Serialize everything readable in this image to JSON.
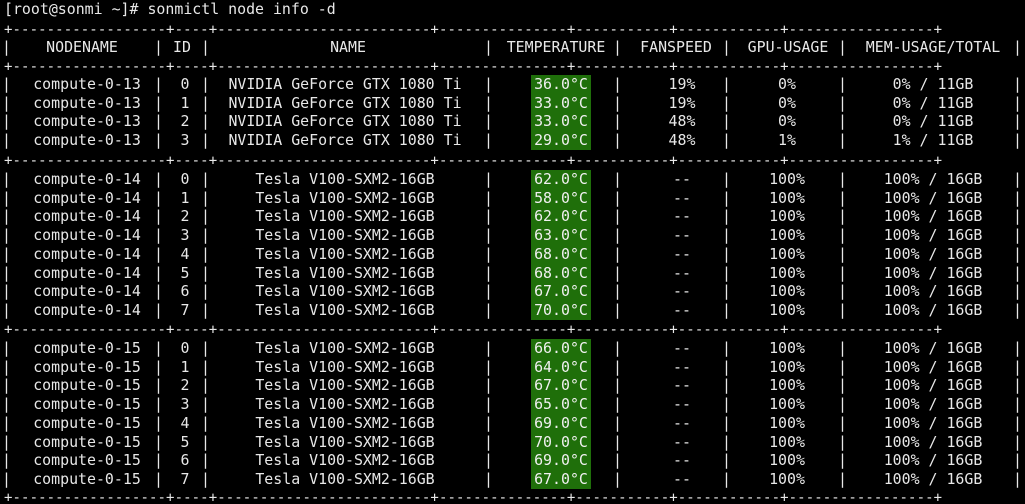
{
  "terminal": {
    "prompt": "[root@sonmi ~]# ",
    "command": "sonmictl node info -d",
    "separator": "+------------------+----+-------------------------+---------------+-----------+------------+-----------------+",
    "headers": {
      "nodename": "NODENAME",
      "id": "ID",
      "name": "NAME",
      "temperature": "TEMPERATURE",
      "fanspeed": "FANSPEED",
      "gpu_usage": "GPU-USAGE",
      "mem_usage": "MEM-USAGE/TOTAL"
    },
    "groups": [
      {
        "rows": [
          {
            "node": "compute-0-13",
            "id": "0",
            "name": "NVIDIA GeForce GTX 1080 Ti",
            "temp": "36.0°C",
            "fan": "19%",
            "gpu": "0%",
            "mem": "0% / 11GB"
          },
          {
            "node": "compute-0-13",
            "id": "1",
            "name": "NVIDIA GeForce GTX 1080 Ti",
            "temp": "33.0°C",
            "fan": "19%",
            "gpu": "0%",
            "mem": "0% / 11GB"
          },
          {
            "node": "compute-0-13",
            "id": "2",
            "name": "NVIDIA GeForce GTX 1080 Ti",
            "temp": "33.0°C",
            "fan": "48%",
            "gpu": "0%",
            "mem": "0% / 11GB"
          },
          {
            "node": "compute-0-13",
            "id": "3",
            "name": "NVIDIA GeForce GTX 1080 Ti",
            "temp": "29.0°C",
            "fan": "48%",
            "gpu": "1%",
            "mem": "1% / 11GB"
          }
        ]
      },
      {
        "rows": [
          {
            "node": "compute-0-14",
            "id": "0",
            "name": "Tesla V100-SXM2-16GB",
            "temp": "62.0°C",
            "fan": "--",
            "gpu": "100%",
            "mem": "100% / 16GB"
          },
          {
            "node": "compute-0-14",
            "id": "1",
            "name": "Tesla V100-SXM2-16GB",
            "temp": "58.0°C",
            "fan": "--",
            "gpu": "100%",
            "mem": "100% / 16GB"
          },
          {
            "node": "compute-0-14",
            "id": "2",
            "name": "Tesla V100-SXM2-16GB",
            "temp": "62.0°C",
            "fan": "--",
            "gpu": "100%",
            "mem": "100% / 16GB"
          },
          {
            "node": "compute-0-14",
            "id": "3",
            "name": "Tesla V100-SXM2-16GB",
            "temp": "63.0°C",
            "fan": "--",
            "gpu": "100%",
            "mem": "100% / 16GB"
          },
          {
            "node": "compute-0-14",
            "id": "4",
            "name": "Tesla V100-SXM2-16GB",
            "temp": "68.0°C",
            "fan": "--",
            "gpu": "100%",
            "mem": "100% / 16GB"
          },
          {
            "node": "compute-0-14",
            "id": "5",
            "name": "Tesla V100-SXM2-16GB",
            "temp": "68.0°C",
            "fan": "--",
            "gpu": "100%",
            "mem": "100% / 16GB"
          },
          {
            "node": "compute-0-14",
            "id": "6",
            "name": "Tesla V100-SXM2-16GB",
            "temp": "67.0°C",
            "fan": "--",
            "gpu": "100%",
            "mem": "100% / 16GB"
          },
          {
            "node": "compute-0-14",
            "id": "7",
            "name": "Tesla V100-SXM2-16GB",
            "temp": "70.0°C",
            "fan": "--",
            "gpu": "100%",
            "mem": "100% / 16GB"
          }
        ]
      },
      {
        "rows": [
          {
            "node": "compute-0-15",
            "id": "0",
            "name": "Tesla V100-SXM2-16GB",
            "temp": "66.0°C",
            "fan": "--",
            "gpu": "100%",
            "mem": "100% / 16GB"
          },
          {
            "node": "compute-0-15",
            "id": "1",
            "name": "Tesla V100-SXM2-16GB",
            "temp": "64.0°C",
            "fan": "--",
            "gpu": "100%",
            "mem": "100% / 16GB"
          },
          {
            "node": "compute-0-15",
            "id": "2",
            "name": "Tesla V100-SXM2-16GB",
            "temp": "67.0°C",
            "fan": "--",
            "gpu": "100%",
            "mem": "100% / 16GB"
          },
          {
            "node": "compute-0-15",
            "id": "3",
            "name": "Tesla V100-SXM2-16GB",
            "temp": "65.0°C",
            "fan": "--",
            "gpu": "100%",
            "mem": "100% / 16GB"
          },
          {
            "node": "compute-0-15",
            "id": "4",
            "name": "Tesla V100-SXM2-16GB",
            "temp": "69.0°C",
            "fan": "--",
            "gpu": "100%",
            "mem": "100% / 16GB"
          },
          {
            "node": "compute-0-15",
            "id": "5",
            "name": "Tesla V100-SXM2-16GB",
            "temp": "70.0°C",
            "fan": "--",
            "gpu": "100%",
            "mem": "100% / 16GB"
          },
          {
            "node": "compute-0-15",
            "id": "6",
            "name": "Tesla V100-SXM2-16GB",
            "temp": "69.0°C",
            "fan": "--",
            "gpu": "100%",
            "mem": "100% / 16GB"
          },
          {
            "node": "compute-0-15",
            "id": "7",
            "name": "Tesla V100-SXM2-16GB",
            "temp": "67.0°C",
            "fan": "--",
            "gpu": "100%",
            "mem": "100% / 16GB"
          }
        ]
      }
    ]
  },
  "colors": {
    "background": "#000000",
    "text": "#e8e8e8",
    "temperature_highlight": "#1f6f0a"
  }
}
